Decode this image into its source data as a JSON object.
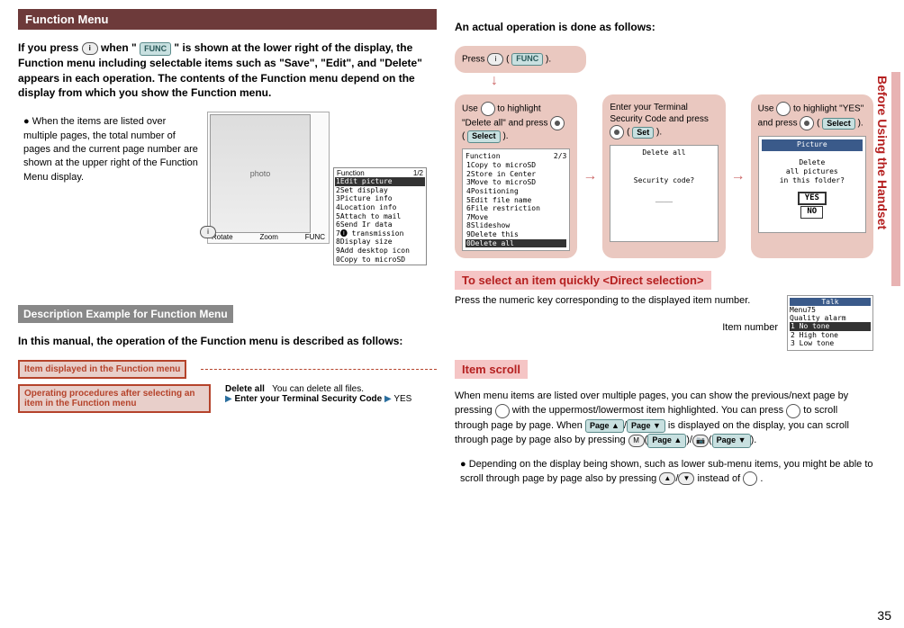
{
  "side_tab": "Before Using the Handset",
  "page_number": "35",
  "left": {
    "h1": "Function Menu",
    "para1": "If you press ",
    "para1b": " when \"",
    "para1c": "\" is shown at the lower right of the display, the Function menu including selectable items such as \"Save\", \"Edit\", and \"Delete\" appears in each operation. The contents of the Function menu depend on the display from which you show the Function menu.",
    "bullet1": "When the items are listed over multiple pages, the total number of pages and the current page number are shown at the upper right of the Function Menu display.",
    "func_label": "FUNC",
    "display": {
      "title": "Function",
      "page": "1/2",
      "items": [
        "Edit picture",
        "Set display",
        "Picture info",
        "Location info",
        "Attach to mail",
        "Send Ir data",
        "🅘 transmission",
        "Display size",
        "Add desktop icon",
        "Copy to microSD"
      ],
      "bottom_left": "Rotate",
      "bottom_mid": "Zoom",
      "bottom_right": "FUNC"
    },
    "h2": "Description Example for Function Menu",
    "para2": "In this manual, the operation of the Function menu is described as follows:",
    "legend1": "Item displayed in the Function menu",
    "legend2": "Operating procedures after selecting an item in the Function menu",
    "delete_bold": "Delete all",
    "delete_desc": "You can delete all files.",
    "delete_proc": "Enter your Terminal Security Code",
    "delete_yes": "YES"
  },
  "right": {
    "heading_actual": "An actual operation is done as follows:",
    "press_box": {
      "text_a": "Press ",
      "text_b": "(",
      "text_c": ").",
      "func": "FUNC"
    },
    "box1": {
      "line1": "Use ",
      "line2": " to highlight \"Delete all\" and press ",
      "line3": "(",
      "line4": ").",
      "btn": "Select"
    },
    "box2": {
      "line1": "Enter your Terminal Security Code and press ",
      "line2": "(",
      "line3": ").",
      "btn": "Set"
    },
    "box3": {
      "line1": "Use ",
      "line2": " to highlight \"YES\" and press ",
      "line3": "(",
      "line4": ").",
      "btn": "Select"
    },
    "screen1": {
      "title": "Function",
      "page": "2/3",
      "items": [
        "Copy to microSD",
        "Store in Center",
        "Move to microSD",
        "Positioning",
        "Edit file name",
        "File restriction",
        "Move",
        "Slideshow",
        "Delete this",
        "Delete all"
      ]
    },
    "screen2": {
      "title": "Delete all",
      "body": "Security code?",
      "under": "____"
    },
    "screen3": {
      "title": "Picture",
      "body1": "Delete",
      "body2": "all pictures",
      "body3": "in this folder?",
      "yes": "YES",
      "no": "NO"
    },
    "h_direct": "To select an item quickly <Direct selection>",
    "direct_text": "Press the numeric key corresponding to the displayed item number.",
    "item_number_label": "Item number",
    "direct_screen": {
      "bar": "Talk",
      "line1": "Menu75",
      "line2": "Quality alarm",
      "items": [
        "No tone",
        "High tone",
        "Low tone"
      ]
    },
    "h_scroll": "Item scroll",
    "scroll_p1a": "When menu items are listed over multiple pages, you can show the previous/next page by pressing ",
    "scroll_p1b": " with the uppermost/lowermost item highlighted. You can press ",
    "scroll_p1c": " to scroll through page by page. When ",
    "page_up": "Page ▲",
    "page_dn": "Page ▼",
    "scroll_p1d": " is displayed on the display, you can scroll through page by page also by pressing ",
    "scroll_p1e": ".",
    "scroll_bullet_a": "Depending on the display being shown, such as lower sub-menu items, you might be able to scroll through page by page also by pressing ",
    "scroll_bullet_b": " instead of ",
    "scroll_bullet_c": "."
  }
}
